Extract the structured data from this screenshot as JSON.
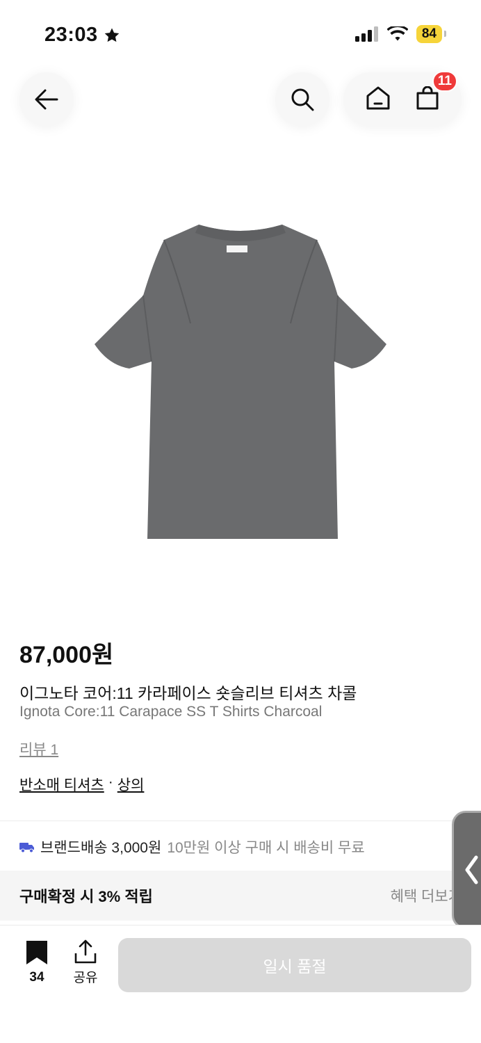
{
  "status_bar": {
    "time": "23:03",
    "battery": "84"
  },
  "nav": {
    "cart_count": "11"
  },
  "product": {
    "price": "87,000원",
    "name_ko": "이그노타 코어:11 카라페이스 숏슬리브 티셔츠 차콜",
    "name_en": "Ignota Core:11 Carapace SS T Shirts Charcoal",
    "review_link": "리뷰 1",
    "category_1": "반소매 티셔츠",
    "category_sep": "·",
    "category_2": "상의"
  },
  "shipping": {
    "label": "브랜드배송 3,000원",
    "note": "10만원 이상 구매 시 배송비 무료"
  },
  "benefit": {
    "text": "구매확정 시 3% 적립",
    "more": "혜택 더보기"
  },
  "bottom_bar": {
    "bookmark_count": "34",
    "share_label": "공유",
    "cta_label": "일시 품절"
  },
  "colors": {
    "badge": "#ef3a3a",
    "battery": "#f6d43a",
    "cta_disabled": "#d9d9d9",
    "shirt": "#6a6b6d"
  }
}
